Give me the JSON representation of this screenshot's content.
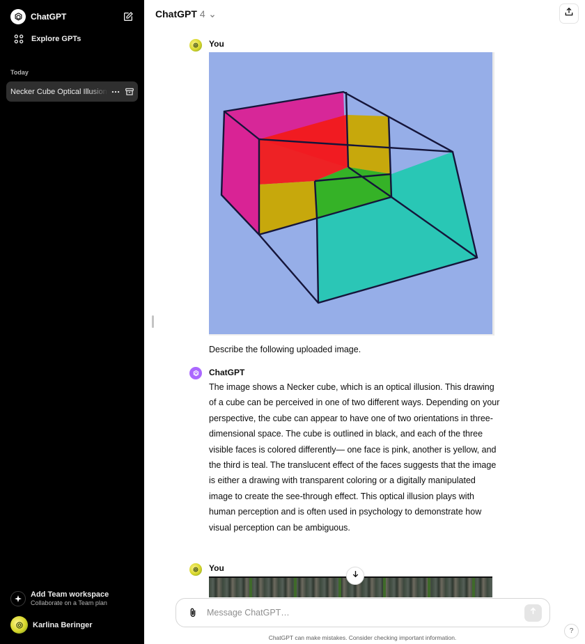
{
  "sidebar": {
    "app_name": "ChatGPT",
    "explore_label": "Explore GPTs",
    "section_today": "Today",
    "chats": [
      {
        "title": "Necker Cube Optical Illusion"
      }
    ],
    "team": {
      "title": "Add Team workspace",
      "subtitle": "Collaborate on a Team plan"
    },
    "user": {
      "name": "Karlina Beringer"
    }
  },
  "header": {
    "model_name": "ChatGPT",
    "model_version": "4"
  },
  "conversation": {
    "messages": [
      {
        "author": "You",
        "text": "Describe the following uploaded image."
      },
      {
        "author": "ChatGPT",
        "text": "The image shows a Necker cube, which is an optical illusion. This drawing of a cube can be perceived in one of two different ways. Depending on your perspective, the cube can appear to have one of two orientations in three-dimensional space. The cube is outlined in black, and each of the three visible faces is colored differently— one face is pink, another is yellow, and the third is teal. The translucent effect of the faces suggests that the image is either a drawing with transparent coloring or a digitally manipulated image to create the see-through effect. This optical illusion plays with human perception and is often used in psychology to demonstrate how visual perception can be ambiguous."
      },
      {
        "author": "You"
      }
    ]
  },
  "composer": {
    "placeholder": "Message ChatGPT…",
    "value": ""
  },
  "footer": {
    "disclaimer": "ChatGPT can make mistakes. Consider checking important information.",
    "help_label": "?"
  },
  "icons": {
    "logo": "openai-logo-icon",
    "new_chat": "new-chat-icon",
    "explore": "grid-icon",
    "more": "ellipsis-icon",
    "archive": "archive-icon",
    "team": "sparkle-icon",
    "share": "share-icon",
    "chevron": "chevron-down-icon",
    "attach": "paperclip-icon",
    "send": "arrow-up-icon",
    "scroll": "arrow-down-icon"
  },
  "colors": {
    "sidebar_bg": "#000000",
    "active_chat_bg": "#2f2f2f",
    "gpt_avatar": "#ab68ff",
    "cube_pink": "#e0148c",
    "cube_yellow": "#c9a800",
    "cube_teal": "#1fc9b0",
    "image_bg": "#96aee8"
  }
}
